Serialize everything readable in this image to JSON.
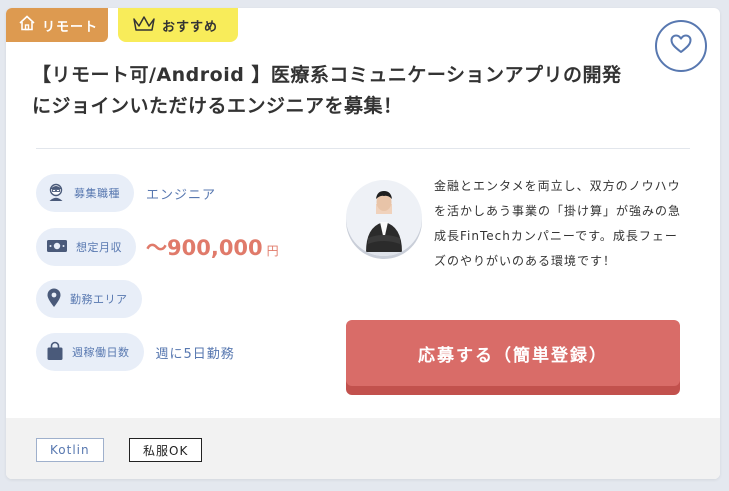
{
  "badges": {
    "remote": "リモート",
    "recommend": "おすすめ"
  },
  "title": "【リモート可/Android 】医療系コミュニケーションアプリの開発 にジョインいただけるエンジニアを募集！",
  "info": {
    "position": {
      "label": "募集職種",
      "value": "エンジニア"
    },
    "salary": {
      "label": "想定月収",
      "value": "〜900,000",
      "unit": "円"
    },
    "area": {
      "label": "勤務エリア",
      "value": ""
    },
    "days": {
      "label": "週稼働日数",
      "value": "週に5日勤務"
    }
  },
  "description": "金融とエンタメを両立し、双方のノウハウを活かしあう事業の「掛け算」が強みの急成長FinTechカンパニーです。成長フェーズのやりがいのある環境です！",
  "apply_label": "応募する（簡単登録）",
  "tags": [
    "Kotlin",
    "私服OK"
  ],
  "colors": {
    "accent_blue": "#5878b0",
    "remote_badge": "#dd9a50",
    "recommend_badge": "#f8ec5a",
    "apply_button": "#d96c68",
    "salary": "#e07a6a"
  },
  "icons": [
    "home-icon",
    "crown-icon",
    "heart-icon",
    "person-icon",
    "money-icon",
    "location-pin-icon",
    "bag-icon"
  ]
}
